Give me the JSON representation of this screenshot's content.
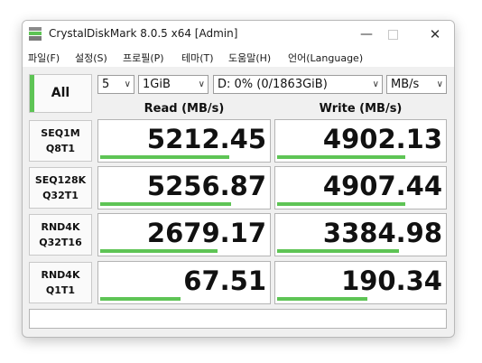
{
  "window": {
    "title": "CrystalDiskMark 8.0.5 x64 [Admin]"
  },
  "menu": [
    "파일(F)",
    "설정(S)",
    "프로필(P)",
    "테마(T)",
    "도움말(H)",
    "언어(Language)"
  ],
  "controls": {
    "all_label": "All",
    "count": "5",
    "size": "1GiB",
    "drive": "D: 0% (0/1863GiB)",
    "unit": "MB/s"
  },
  "headers": {
    "read": "Read (MB/s)",
    "write": "Write (MB/s)"
  },
  "tests": [
    {
      "l1": "SEQ1M",
      "l2": "Q8T1",
      "read": "5212.45",
      "write": "4902.13",
      "read_frac": 0.77,
      "write_frac": 0.77
    },
    {
      "l1": "SEQ128K",
      "l2": "Q32T1",
      "read": "5256.87",
      "write": "4907.44",
      "read_frac": 0.78,
      "write_frac": 0.77
    },
    {
      "l1": "RND4K",
      "l2": "Q32T16",
      "read": "2679.17",
      "write": "3384.98",
      "read_frac": 0.7,
      "write_frac": 0.73
    },
    {
      "l1": "RND4K",
      "l2": "Q1T1",
      "read": "67.51",
      "write": "190.34",
      "read_frac": 0.48,
      "write_frac": 0.54
    }
  ],
  "status_text": "",
  "colors": {
    "bar": "#5ec455",
    "window_bg": "#f0f0f0"
  }
}
